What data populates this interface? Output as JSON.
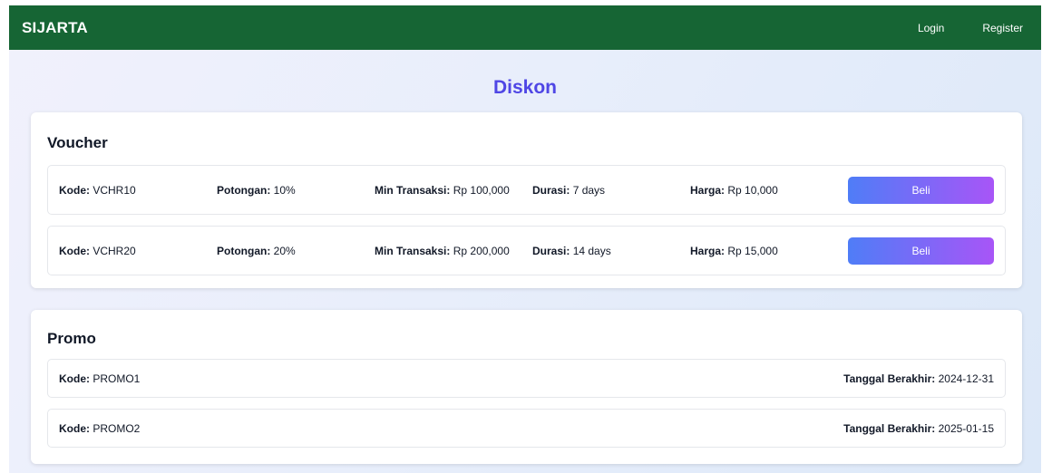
{
  "navbar": {
    "brand": "SIJARTA",
    "login": "Login",
    "register": "Register"
  },
  "page": {
    "title": "Diskon"
  },
  "voucher": {
    "title": "Voucher",
    "labels": {
      "code": "Kode:",
      "discount": "Potongan:",
      "min": "Min Transaksi:",
      "duration": "Durasi:",
      "price": "Harga:"
    },
    "button_label": "Beli",
    "items": [
      {
        "code": "VCHR10",
        "discount": "10%",
        "min": "Rp 100,000",
        "duration": "7 days",
        "price": "Rp 10,000"
      },
      {
        "code": "VCHR20",
        "discount": "20%",
        "min": "Rp 200,000",
        "duration": "14 days",
        "price": "Rp 15,000"
      }
    ]
  },
  "promo": {
    "title": "Promo",
    "labels": {
      "code": "Kode:",
      "end_date": "Tanggal Berakhir:"
    },
    "items": [
      {
        "code": "PROMO1",
        "end_date": "2024-12-31"
      },
      {
        "code": "PROMO2",
        "end_date": "2025-01-15"
      }
    ]
  },
  "colors": {
    "navbar": "#166534",
    "title": "#4f46e5",
    "button_from": "#4f7df7",
    "button_to": "#a855f7"
  }
}
